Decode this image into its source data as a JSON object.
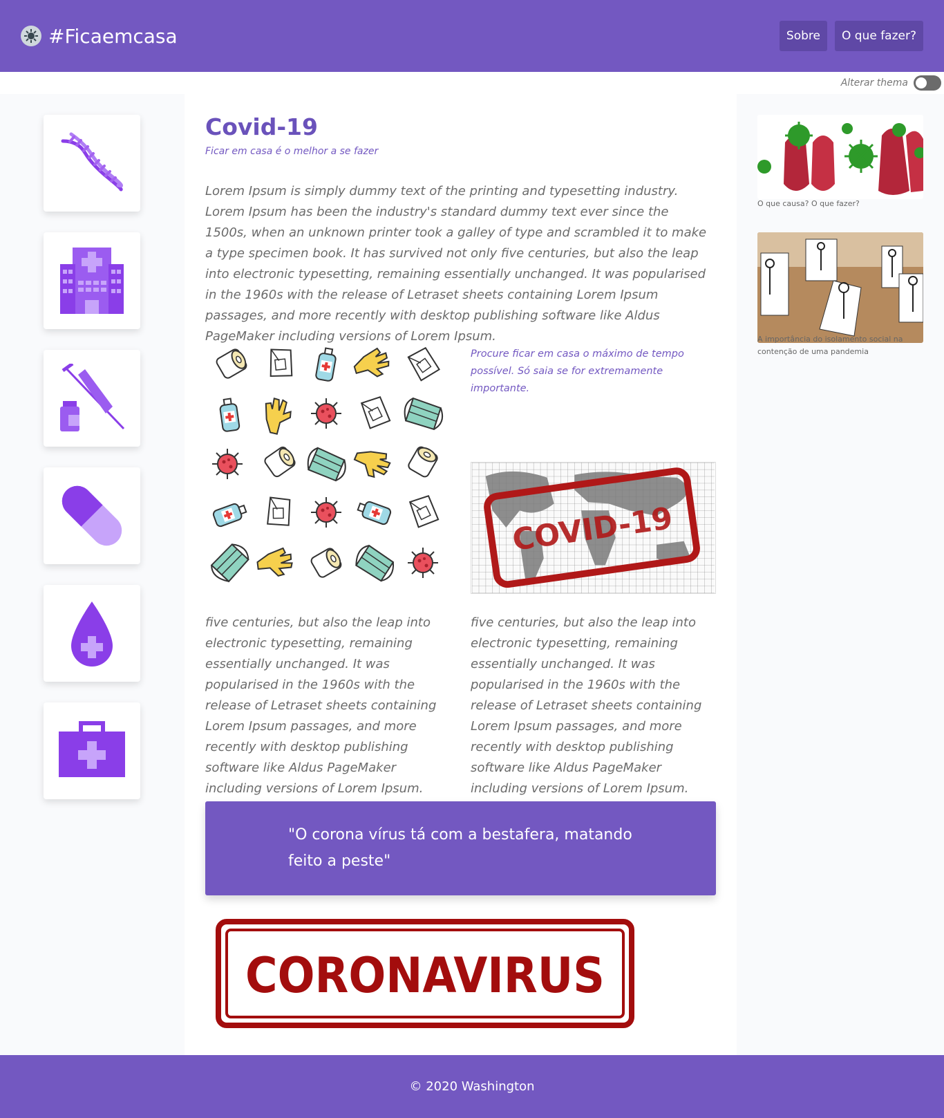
{
  "header": {
    "brand": "#Ficaemcasa",
    "nav": [
      "Sobre",
      "O que fazer?"
    ]
  },
  "theme": {
    "label": "Alterar thema",
    "enabled": false
  },
  "sidebar_icons": [
    "dna-icon",
    "hospital-icon",
    "syringe-icon",
    "pill-icon",
    "blood-drop-icon",
    "first-aid-kit-icon"
  ],
  "main": {
    "title": "Covid-19",
    "subtitle": "Ficar em casa é o melhor a se fazer",
    "lead": "Lorem Ipsum is simply dummy text of the printing and typesetting industry. Lorem Ipsum has been the industry's standard dummy text ever since the 1500s, when an unknown printer took a galley of type and scrambled it to make a type specimen book. It has survived not only five centuries, but also the leap into electronic typesetting, remaining essentially unchanged. It was popularised in the 1960s with the release of Letraset sheets containing Lorem Ipsum passages, and more recently with desktop publishing software like Aldus PageMaker including versions of Lorem Ipsum.",
    "note": "Procure ficar em casa o máximo de tempo possível. Só saia se for extremamente importante.",
    "stamp_text": "COVID-19",
    "col_left": "five centuries, but also the leap into electronic typesetting, remaining essentially unchanged. It was popularised in the 1960s with the release of Letraset sheets containing Lorem Ipsum passages, and more recently with desktop publishing software like Aldus PageMaker including versions of Lorem Ipsum.",
    "col_right": "five centuries, but also the leap into electronic typesetting, remaining essentially unchanged. It was popularised in the 1960s with the release of Letraset sheets containing Lorem Ipsum passages, and more recently with desktop publishing software like Aldus PageMaker including versions of Lorem Ipsum.",
    "quote": "\"O corona vírus tá com a bestafera, matando feito a peste\"",
    "corona_stamp": "CORONAVIRUS"
  },
  "aside": [
    {
      "caption": "O que causa? O que fazer?"
    },
    {
      "caption": "A importância do isolamento social na contenção de uma pandemia"
    }
  ],
  "footer": {
    "text": "© 2020 Washington"
  },
  "colors": {
    "primary": "#7358c1",
    "accent": "#8a3ee8",
    "stamp_red": "#b01818"
  }
}
